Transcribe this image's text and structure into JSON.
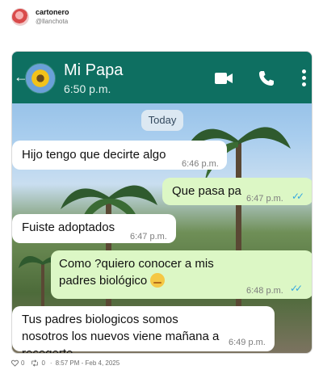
{
  "tweet": {
    "author_name": "cartonero",
    "author_handle": "@llanchota",
    "reply_count": "0",
    "retweet_count": "0",
    "timestamp": "8:57 PM - Feb 4, 2025",
    "icons": [
      "heart-icon",
      "retweet-icon"
    ]
  },
  "chat": {
    "contact_name": "Mi Papa",
    "contact_status": "6:50 p.m.",
    "date_label": "Today",
    "header_color": "#0e6f61",
    "incoming_color": "#ffffff",
    "outgoing_color": "#dcf7c5",
    "messages": [
      {
        "direction": "in",
        "text": "Hijo tengo que decirte algo",
        "time": "6:46 p.m."
      },
      {
        "direction": "out",
        "text": "Que pasa pa",
        "time": "6:47 p.m."
      },
      {
        "direction": "in",
        "text": "Fuiste adoptados",
        "time": "6:47 p.m."
      },
      {
        "direction": "out",
        "text": "Como ?quiero conocer a mis padres biológico",
        "time": "6:48 p.m."
      },
      {
        "direction": "in",
        "text": "Tus padres biologicos somos nosotros los nuevos viene mañana a recogerte",
        "time": "6:49 p.m."
      }
    ]
  }
}
